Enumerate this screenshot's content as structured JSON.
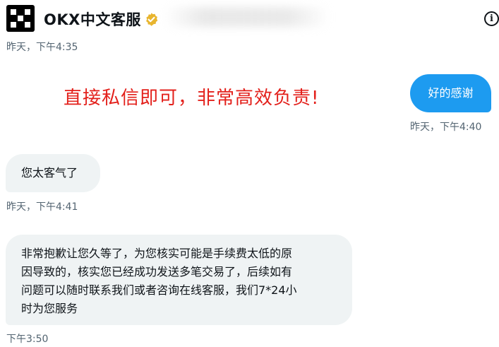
{
  "header": {
    "title": "OKX中文客服",
    "verified_icon": "verified-badge-icon",
    "verified_color": "#e8b52f",
    "info_icon": "info-icon",
    "info_glyph": "i"
  },
  "messages": [
    {
      "direction": "received",
      "timestamp": "昨天，下午4:35"
    },
    {
      "direction": "sent",
      "text": "好的感谢",
      "timestamp": "昨天，下午4:40"
    },
    {
      "direction": "received",
      "text": "您太客气了",
      "timestamp": "昨天，下午4:41"
    },
    {
      "direction": "received",
      "lines": [
        "非常抱歉让您久等了，为您核实可能是手续费太低的原",
        "因导致的，核实您已经成功发送多笔交易了，后续如有",
        "问题可以随时联系我们或者咨询在线客服，我们7*24小",
        "时为您服务"
      ],
      "timestamp": "下午3:50"
    }
  ],
  "overlay_text": "直接私信即可，非常高效负责!",
  "colors": {
    "sent_bubble": "#1d9bf0",
    "received_bubble": "#eff3f4",
    "timestamp": "#536471",
    "overlay": "#e3201b"
  }
}
